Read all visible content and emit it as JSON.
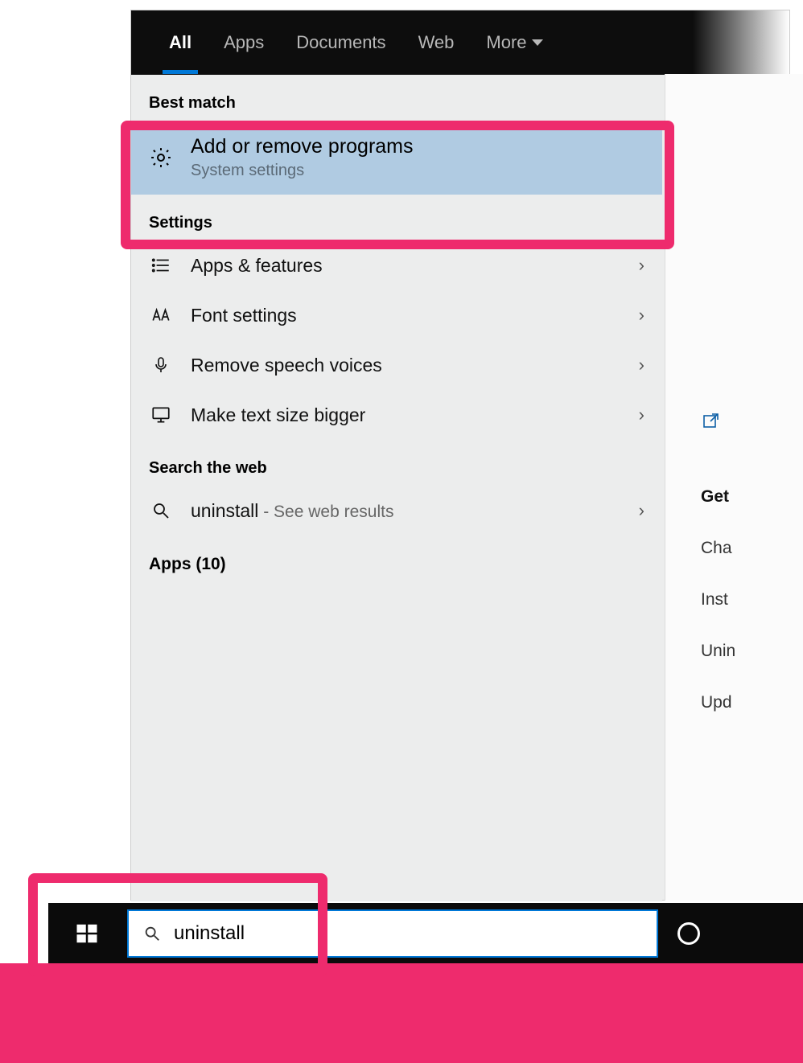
{
  "tabs": {
    "all": "All",
    "apps": "Apps",
    "documents": "Documents",
    "web": "Web",
    "more": "More"
  },
  "sections": {
    "best_match": "Best match",
    "settings": "Settings",
    "search_web": "Search the web",
    "apps_header": "Apps (10)"
  },
  "best_match": {
    "title": "Add or remove programs",
    "subtitle": "System settings"
  },
  "settings_items": [
    {
      "label": "Apps & features",
      "icon": "list"
    },
    {
      "label": "Font settings",
      "icon": "font"
    },
    {
      "label": "Remove speech voices",
      "icon": "mic"
    },
    {
      "label": "Make text size bigger",
      "icon": "monitor"
    }
  ],
  "web_search": {
    "query": "uninstall",
    "hint": " - See web results"
  },
  "search_input": {
    "value": "uninstall"
  },
  "side_panel": {
    "heading": "Get",
    "items": [
      "Cha",
      "Inst",
      "Unin",
      "Upd"
    ]
  }
}
